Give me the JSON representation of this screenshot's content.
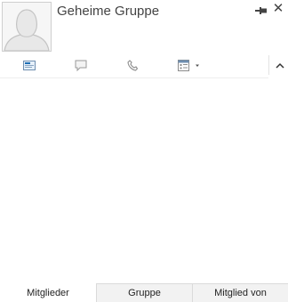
{
  "contact": {
    "name": "Geheime Gruppe",
    "avatar_icon": "person-silhouette-icon"
  },
  "window": {
    "pin_icon": "pin-icon",
    "close_label": "✕"
  },
  "toolbar": {
    "items": [
      {
        "icon": "email-icon"
      },
      {
        "icon": "instant-message-icon"
      },
      {
        "icon": "phone-icon"
      },
      {
        "icon": "schedule-meeting-icon"
      }
    ],
    "collapse_icon": "chevron-up-icon"
  },
  "tabs": [
    {
      "label": "Mitglieder",
      "selected": true
    },
    {
      "label": "Gruppe",
      "selected": false
    },
    {
      "label": "Mitglied von",
      "selected": false
    }
  ],
  "colors": {
    "text": "#444444",
    "icon": "#8c8c8c",
    "accent_icon": "#1e6fb5",
    "tab_inactive_bg": "#f2f2f2",
    "border": "#dadada"
  }
}
